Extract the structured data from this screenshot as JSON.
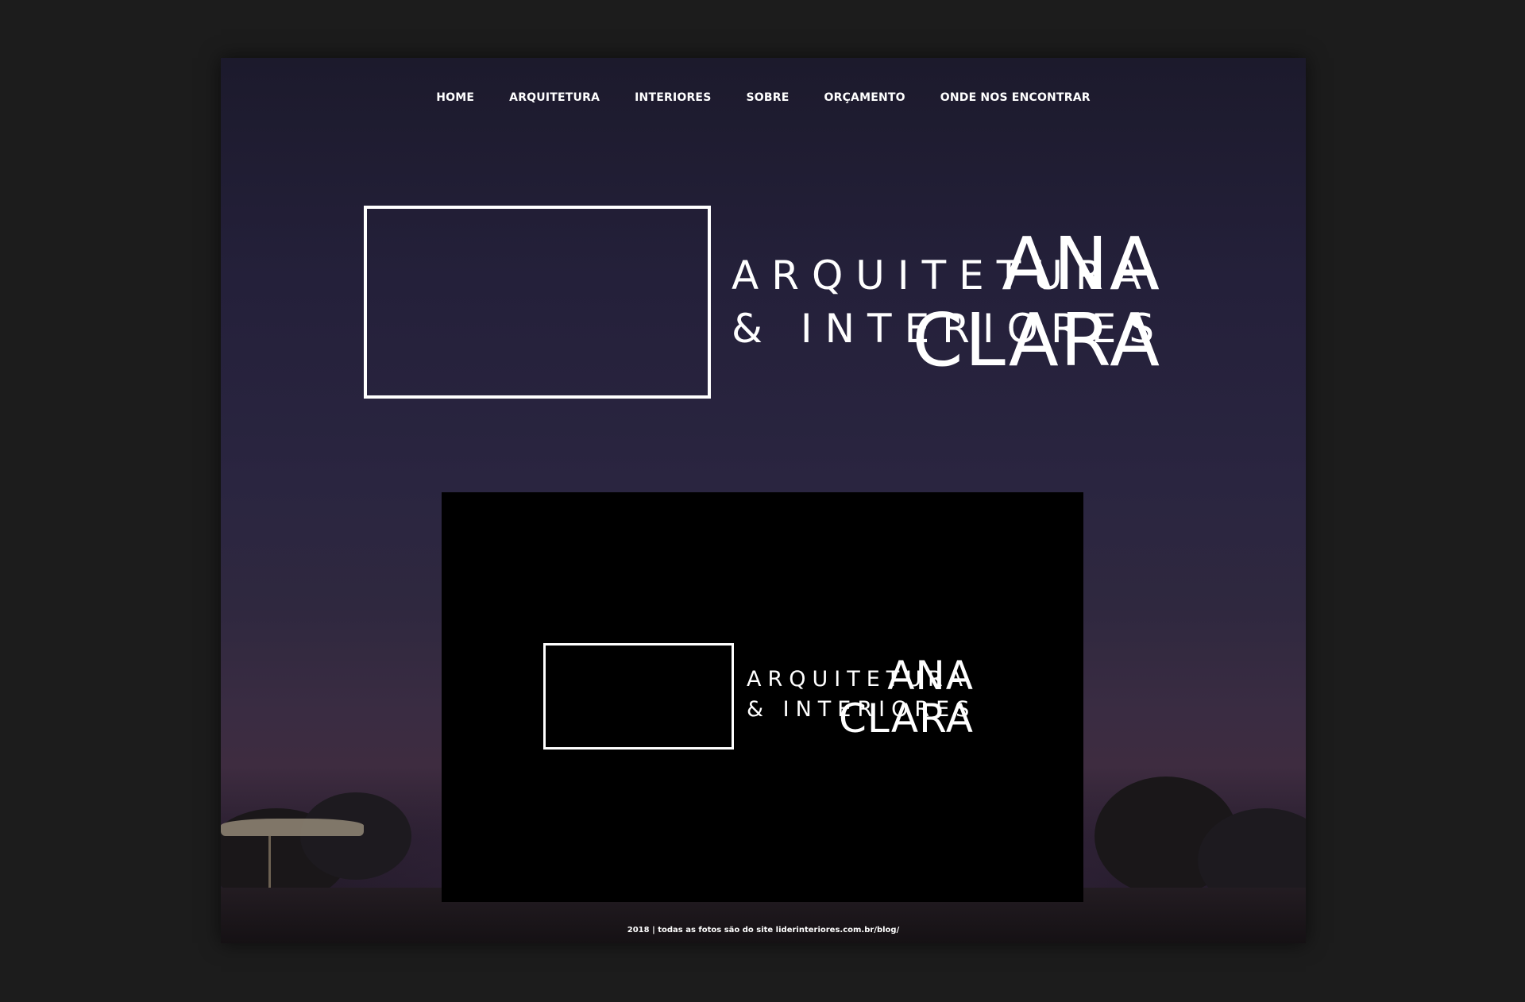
{
  "nav": {
    "items": [
      {
        "label": "HOME"
      },
      {
        "label": "ARQUITETURA"
      },
      {
        "label": "INTERIORES"
      },
      {
        "label": "SOBRE"
      },
      {
        "label": "ORÇAMENTO"
      },
      {
        "label": "ONDE NOS ENCONTRAR"
      }
    ]
  },
  "logo": {
    "name_line1": "ANA",
    "name_line2": "CLARA",
    "tagline_line1": "ARQUITETURA",
    "tagline_line2": "& INTERIORES"
  },
  "footer": {
    "text": "2018 | todas as fotos são do site liderinteriores.com.br/blog/"
  },
  "colors": {
    "page_background": "#1c1c1c",
    "hero_sky": "#2a2540",
    "text": "#ffffff",
    "panel": "#000000"
  }
}
